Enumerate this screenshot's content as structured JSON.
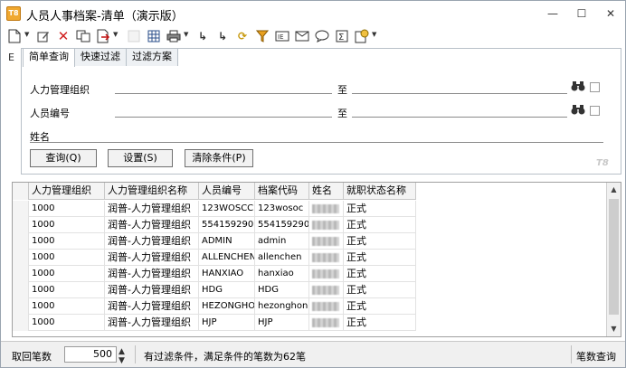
{
  "window": {
    "title": "人员人事档案-清单（演示版）",
    "app_icon": "T8"
  },
  "toolbar": {
    "icons": [
      "new-doc-icon",
      "edit-icon",
      "delete-icon",
      "copy-icon",
      "export-icon",
      "disabled-icon",
      "grid-icon",
      "print-icon",
      "locate-icon",
      "locate-next-icon",
      "refresh-icon",
      "filter-icon",
      "field-icon",
      "mail-icon",
      "comment-icon",
      "sum-icon",
      "settings-icon"
    ]
  },
  "side_label": "E",
  "query": {
    "tabs": [
      "简单查询",
      "快速过滤",
      "过滤方案"
    ],
    "active_tab": "简单查询",
    "fields": [
      {
        "label": "人力管理组织",
        "to": "至"
      },
      {
        "label": "人员编号",
        "to": "至"
      },
      {
        "label": "姓名"
      }
    ],
    "buttons": {
      "query": "查询(Q)",
      "settings": "设置(S)",
      "clear": "清除条件(P)"
    },
    "brand": "T8"
  },
  "grid": {
    "columns": [
      "人力管理组织",
      "人力管理组织名称",
      "人员编号",
      "档案代码",
      "姓名",
      "就职状态名称"
    ],
    "rows": [
      {
        "org": "1000",
        "org_name": "润普-人力管理组织",
        "emp_no": "123WOSCC",
        "code": "123wosoc",
        "status": "正式"
      },
      {
        "org": "1000",
        "org_name": "润普-人力管理组织",
        "emp_no": "554159290",
        "code": "554159290",
        "status": "正式"
      },
      {
        "org": "1000",
        "org_name": "润普-人力管理组织",
        "emp_no": "ADMIN",
        "code": "admin",
        "status": "正式"
      },
      {
        "org": "1000",
        "org_name": "润普-人力管理组织",
        "emp_no": "ALLENCHEN",
        "code": "allenchen",
        "status": "正式"
      },
      {
        "org": "1000",
        "org_name": "润普-人力管理组织",
        "emp_no": "HANXIAO",
        "code": "hanxiao",
        "status": "正式"
      },
      {
        "org": "1000",
        "org_name": "润普-人力管理组织",
        "emp_no": "HDG",
        "code": "HDG",
        "status": "正式"
      },
      {
        "org": "1000",
        "org_name": "润普-人力管理组织",
        "emp_no": "HEZONGHONG",
        "code": "hezonghong",
        "status": "正式"
      },
      {
        "org": "1000",
        "org_name": "润普-人力管理组织",
        "emp_no": "HJP",
        "code": "HJP",
        "status": "正式"
      }
    ]
  },
  "status": {
    "fetch_label": "取回笔数",
    "fetch_value": "500",
    "message": "有过滤条件，满足条件的笔数为62笔",
    "mode": "笔数查询"
  }
}
